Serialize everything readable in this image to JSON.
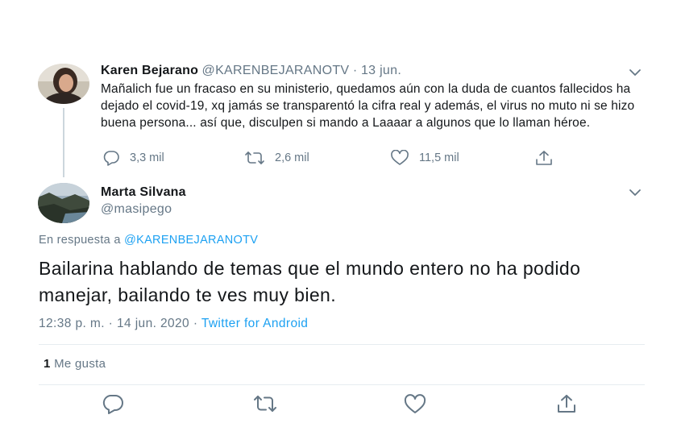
{
  "parent_tweet": {
    "author_name": "Karen Bejarano",
    "author_handle": "@KARENBEJARANOTV",
    "separator": "·",
    "date": "13 jun.",
    "text": "Mañalich fue un fracaso en su ministerio, quedamos aún con la duda de cuantos fallecidos ha dejado el covid-19, xq jamás se transparentó la cifra real y además, el virus no muto ni se hizo buena persona... así que, disculpen si mando a Laaaar a algunos que lo llaman héroe.",
    "replies": "3,3 mil",
    "retweets": "2,6 mil",
    "likes": "11,5 mil",
    "avatar": "avatar-photo-woman"
  },
  "main_tweet": {
    "author_name": "Marta Silvana",
    "author_handle": "@masipego",
    "avatar": "avatar-photo-landscape",
    "reply_prefix": "En respuesta a",
    "reply_to": "@KARENBEJARANOTV",
    "text": "Bailarina hablando de temas que el mundo entero no ha podido manejar, bailando te ves muy bien.",
    "time": "12:38 p. m.",
    "separator": "·",
    "date": "14 jun. 2020",
    "source": "Twitter for Android",
    "like_count": "1",
    "like_label": "Me gusta"
  },
  "colors": {
    "text": "#14171a",
    "secondary": "#657786",
    "link": "#1da1f2",
    "divider": "#e6ecf0",
    "thread_line": "#ccd6dd"
  },
  "icons": {
    "reply": "comment-icon",
    "retweet": "retweet-icon",
    "like": "heart-icon",
    "share": "share-icon",
    "menu": "chevron-down-icon"
  }
}
